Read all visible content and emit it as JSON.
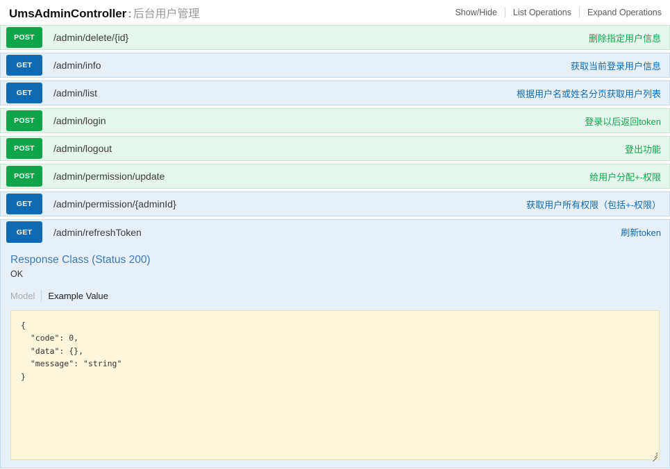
{
  "header": {
    "tag_name": "UmsAdminController",
    "separator": ":",
    "tag_description": "后台用户管理",
    "options": {
      "show_hide": "Show/Hide",
      "list_operations": "List Operations",
      "expand_operations": "Expand Operations"
    }
  },
  "colors": {
    "post_badge": "#10a54a",
    "get_badge": "#0f6ab4",
    "post_row_bg": "#e7f6ec",
    "get_row_bg": "#e7f0f7",
    "code_bg": "#fcf6db",
    "link_blue": "#3b7ab5"
  },
  "operations": [
    {
      "method": "POST",
      "path": "/admin/delete/{id}",
      "summary": "删除指定用户信息",
      "expanded": false
    },
    {
      "method": "GET",
      "path": "/admin/info",
      "summary": "获取当前登录用户信息",
      "expanded": false
    },
    {
      "method": "GET",
      "path": "/admin/list",
      "summary": "根据用户名或姓名分页获取用户列表",
      "expanded": false
    },
    {
      "method": "POST",
      "path": "/admin/login",
      "summary": "登录以后返回token",
      "expanded": false
    },
    {
      "method": "POST",
      "path": "/admin/logout",
      "summary": "登出功能",
      "expanded": false
    },
    {
      "method": "POST",
      "path": "/admin/permission/update",
      "summary": "给用户分配+-权限",
      "expanded": false
    },
    {
      "method": "GET",
      "path": "/admin/permission/{adminId}",
      "summary": "获取用户所有权限（包括+-权限）",
      "expanded": false
    },
    {
      "method": "GET",
      "path": "/admin/refreshToken",
      "summary": "刷新token",
      "expanded": true
    }
  ],
  "expanded_detail": {
    "response_class_title": "Response Class (Status 200)",
    "response_status_text": "OK",
    "tabs": {
      "model": "Model",
      "example_value": "Example Value"
    },
    "example_value_lines": [
      "{",
      "  \"code\": 0,",
      "  \"data\": {},",
      "  \"message\": \"string\"",
      "}"
    ],
    "example_value_text": "{\n  \"code\": 0,\n  \"data\": {},\n  \"message\": \"string\"\n}",
    "resize_handle": "resize-grip-icon"
  }
}
